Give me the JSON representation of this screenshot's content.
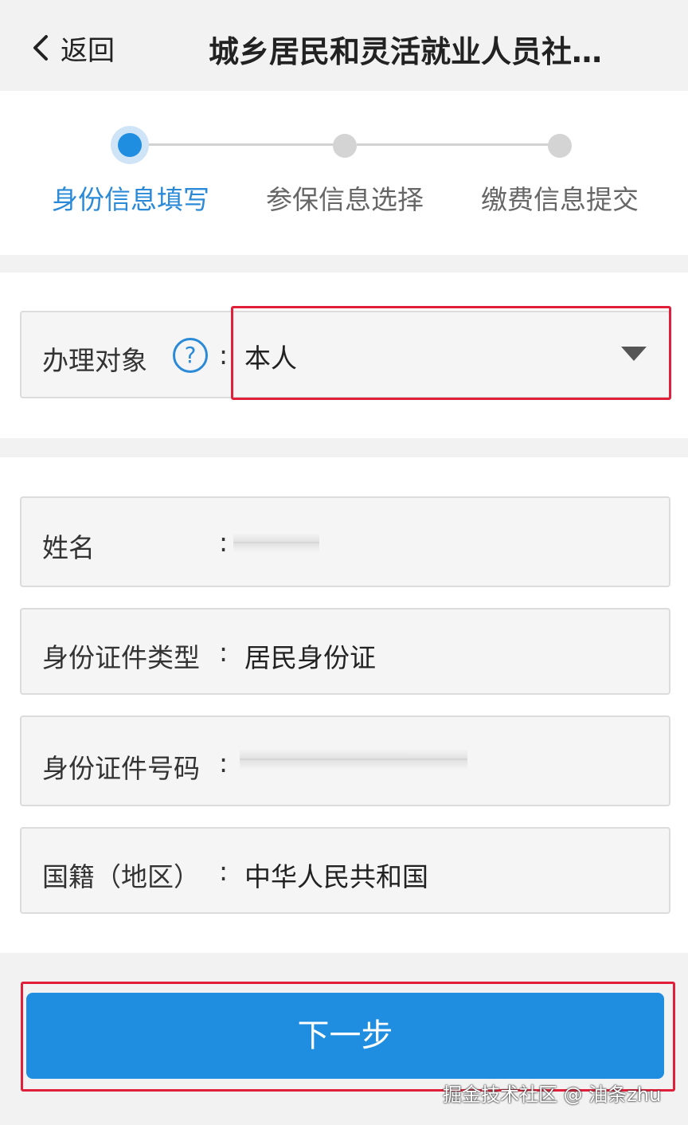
{
  "header": {
    "back_label": "返回",
    "title": "城乡居民和灵活就业人员社…"
  },
  "steps": [
    {
      "label": "身份信息填写",
      "state": "active"
    },
    {
      "label": "参保信息选择",
      "state": "pending"
    },
    {
      "label": "缴费信息提交",
      "state": "pending"
    }
  ],
  "applicant": {
    "label": "办理对象",
    "help": "?",
    "colon": ":",
    "value": "本人"
  },
  "form": {
    "name": {
      "label": "姓名",
      "colon": ":"
    },
    "id_type": {
      "label": "身份证件类型",
      "colon": ":",
      "value": "居民身份证"
    },
    "id_number": {
      "label": "身份证件号码",
      "colon": ":"
    },
    "nationality": {
      "label": "国籍（地区）",
      "colon": ":",
      "value": "中华人民共和国"
    }
  },
  "footer": {
    "next_label": "下一步",
    "watermark": "掘金技术社区 @ 油条zhu"
  },
  "colors": {
    "accent": "#1f8de0",
    "highlight": "#e0203a",
    "step_active_text": "#2a8ad8"
  }
}
